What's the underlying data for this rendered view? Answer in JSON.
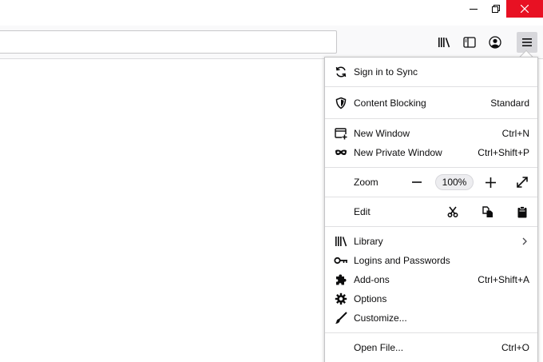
{
  "window": {
    "minimize_icon": "minimize-icon",
    "maximize_icon": "restore-icon",
    "close_icon": "close-icon",
    "close_color": "#e81123"
  },
  "toolbar": {
    "url_value": "",
    "icons": [
      "library-icon",
      "sidebar-icon",
      "account-icon",
      "hamburger-menu-icon"
    ]
  },
  "menu": {
    "sync": {
      "label": "Sign in to Sync",
      "icon": "sync-icon"
    },
    "content_blocking": {
      "label": "Content Blocking",
      "value": "Standard",
      "icon": "shield-icon"
    },
    "new_window": {
      "label": "New Window",
      "shortcut": "Ctrl+N",
      "icon": "new-window-icon"
    },
    "new_private_window": {
      "label": "New Private Window",
      "shortcut": "Ctrl+Shift+P",
      "icon": "private-mask-icon"
    },
    "zoom": {
      "label": "Zoom",
      "value": "100%"
    },
    "edit": {
      "label": "Edit"
    },
    "library": {
      "label": "Library",
      "icon": "library-icon"
    },
    "logins": {
      "label": "Logins and Passwords",
      "icon": "key-icon"
    },
    "addons": {
      "label": "Add-ons",
      "shortcut": "Ctrl+Shift+A",
      "icon": "puzzle-icon"
    },
    "options": {
      "label": "Options",
      "icon": "gear-icon"
    },
    "customize": {
      "label": "Customize...",
      "icon": "paintbrush-icon"
    },
    "open_file": {
      "label": "Open File...",
      "shortcut": "Ctrl+O"
    }
  }
}
